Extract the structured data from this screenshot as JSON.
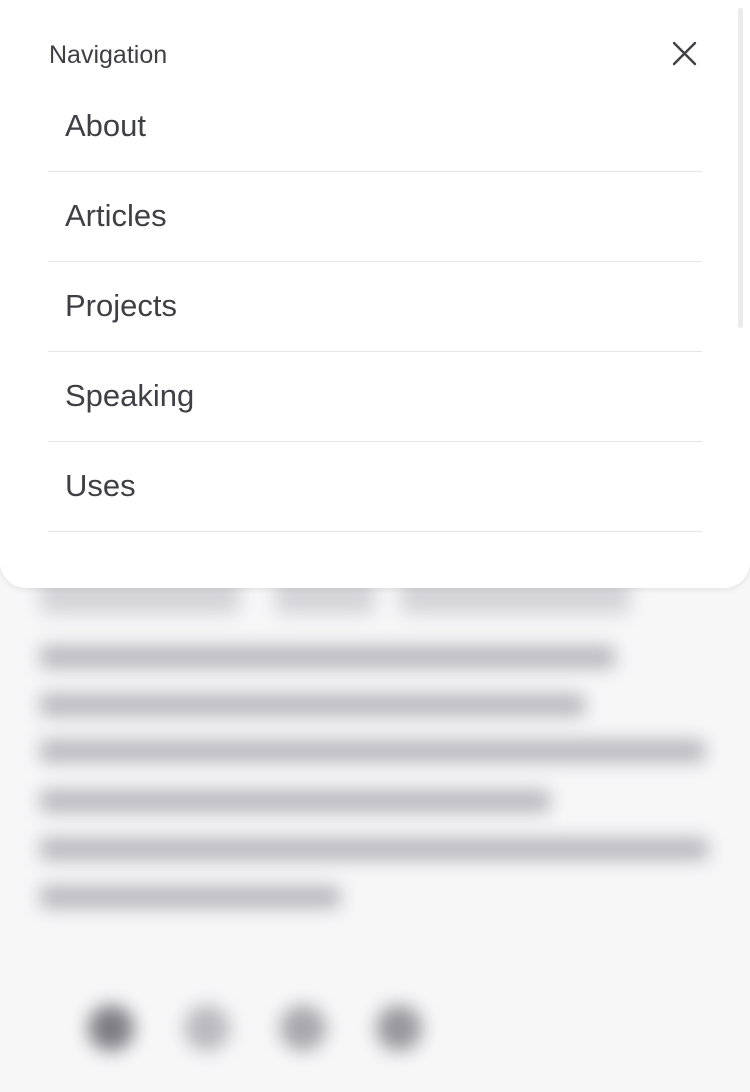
{
  "menu": {
    "title": "Navigation",
    "close_icon": "close-icon",
    "items": [
      {
        "label": "About"
      },
      {
        "label": "Articles"
      },
      {
        "label": "Projects"
      },
      {
        "label": "Speaking"
      },
      {
        "label": "Uses"
      }
    ]
  },
  "colors": {
    "panel_background": "#ffffff",
    "text": "#3f3f46",
    "divider": "#e4e4e7",
    "page_background": "#f7f7f8"
  },
  "background_social_icons": [
    "social-icon",
    "social-icon",
    "social-icon",
    "social-icon"
  ]
}
